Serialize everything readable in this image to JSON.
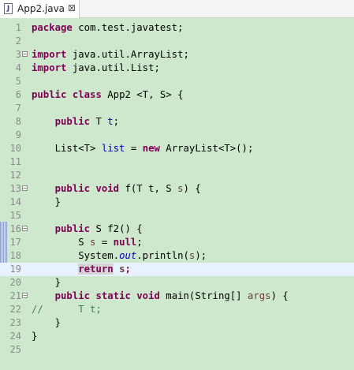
{
  "tab": {
    "icon": "java-file-icon",
    "label": "App2.java",
    "close": "⊠"
  },
  "lines": [
    {
      "n": "1",
      "text": "package com.test.javatest;"
    },
    {
      "n": "2",
      "text": ""
    },
    {
      "n": "3",
      "text": "import java.util.ArrayList;",
      "fold": "−"
    },
    {
      "n": "4",
      "text": "import java.util.List;"
    },
    {
      "n": "5",
      "text": ""
    },
    {
      "n": "6",
      "text": "public class App2 <T, S> {"
    },
    {
      "n": "7",
      "text": ""
    },
    {
      "n": "8",
      "text": "    public T t;"
    },
    {
      "n": "9",
      "text": ""
    },
    {
      "n": "10",
      "text": "    List<T> list = new ArrayList<T>();"
    },
    {
      "n": "11",
      "text": ""
    },
    {
      "n": "12",
      "text": ""
    },
    {
      "n": "13",
      "text": "    public void f(T t, S s) {",
      "fold": "−"
    },
    {
      "n": "14",
      "text": "    }"
    },
    {
      "n": "15",
      "text": ""
    },
    {
      "n": "16",
      "text": "    public S f2() {",
      "fold": "−"
    },
    {
      "n": "17",
      "text": "        S s = null;"
    },
    {
      "n": "18",
      "text": "        System.out.println(s);"
    },
    {
      "n": "19",
      "text": "        return s;"
    },
    {
      "n": "20",
      "text": "    }"
    },
    {
      "n": "21",
      "text": "    public static void main(String[] args) {",
      "fold": "−"
    },
    {
      "n": "22",
      "text": "//      T t;"
    },
    {
      "n": "23",
      "text": "    }"
    },
    {
      "n": "24",
      "text": "}"
    },
    {
      "n": "25",
      "text": ""
    }
  ],
  "colors": {
    "editor_bg": "#cde8cc",
    "keyword": "#7f0055",
    "field": "#0000c0",
    "comment": "#3f7f5f",
    "local_variable": "#6a3e3e",
    "current_line": "#e8f2fe"
  }
}
